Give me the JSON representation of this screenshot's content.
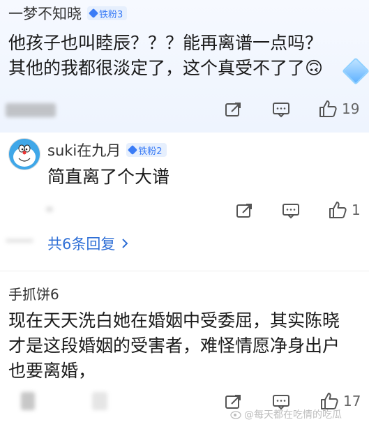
{
  "comments": [
    {
      "username": "一梦不知晓",
      "badge": "铁粉3",
      "text_lines": [
        "他孩子也叫睦辰？？？能再离谱一点吗？",
        "其他的我都很淡定了，这个真受不了了🙃"
      ],
      "likes": "19"
    },
    {
      "username": "suki在九月",
      "badge": "铁粉2",
      "text_lines": [
        "简直离了个大谱"
      ],
      "likes": "1"
    },
    {
      "username": "手抓饼6",
      "text_lines": [
        "现在天天洗白她在婚姻中受委屈，其实陈晓",
        "才是这段婚姻的受害者，难怪情愿净身出户",
        "也要离婚，"
      ],
      "likes": "17"
    }
  ],
  "replies_link": "共6条回复",
  "watermark": "@每天都在吃情的吃瓜",
  "colors": {
    "accent": "#3b7cf6",
    "link": "#2f6fd6",
    "badge_bg": "#e6effd"
  },
  "icons": [
    "share-icon",
    "comment-icon",
    "like-icon",
    "diamond-icon",
    "doraemon-avatar",
    "chevron-right-icon",
    "weibo-logo-icon"
  ]
}
